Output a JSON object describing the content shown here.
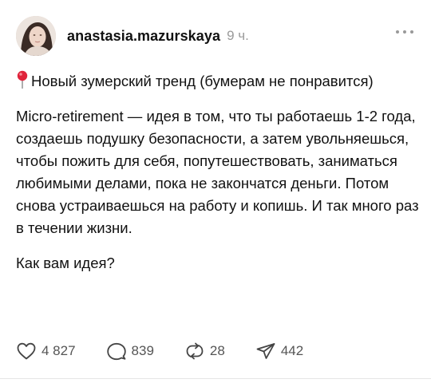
{
  "post": {
    "author": "anastasia.mazurskaya",
    "time": "9 ч.",
    "title": "Новый зумерский тренд (бумерам не понравится)",
    "paragraph": "Micro-retirement — идея в том, что ты работаешь 1-2 года, создаешь подушку безопасности, а затем увольняешься, чтобы пожить для себя, попутешествовать, заниматься любимыми делами, пока не закончатся деньги. Потом снова устраиваешься на работу и копишь. И так много раз в течении жизни.",
    "question": "Как вам идея?",
    "title_icon": "round-pushpin-icon"
  },
  "actions": {
    "likes": "4 827",
    "comments": "839",
    "reposts": "28",
    "shares": "442"
  },
  "icons": {
    "like": "heart-icon",
    "comment": "comment-bubble-icon",
    "repost": "repost-arrows-icon",
    "share": "send-icon",
    "more": "more-dots-icon"
  }
}
